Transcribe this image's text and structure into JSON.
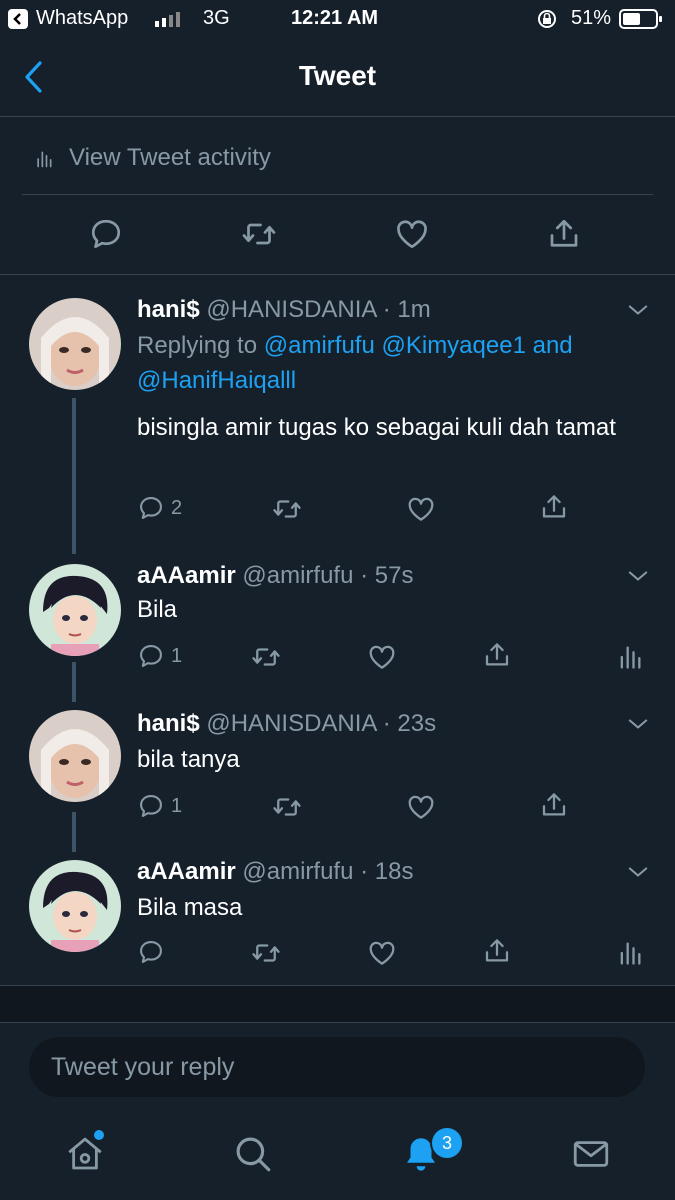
{
  "status_bar": {
    "back_app": "WhatsApp",
    "network": "3G",
    "time": "12:21 AM",
    "battery": "51%"
  },
  "nav": {
    "title": "Tweet"
  },
  "activity": {
    "label": "View Tweet activity"
  },
  "tweets": [
    {
      "name": "hani$",
      "handle": "@HANISDANIA",
      "time": "1m",
      "reply_prefix": "Replying to ",
      "reply_users": [
        "@amirfufu",
        "@Kimyaqee1"
      ],
      "reply_and": " and ",
      "reply_last": "@HanifHaiqalll",
      "text": "bisingla amir tugas ko sebagai kuli dah tamat",
      "replies": "2"
    },
    {
      "name": "aAAamir",
      "handle": "@amirfufu",
      "time": "57s",
      "text": "Bila",
      "replies": "1"
    },
    {
      "name": "hani$",
      "handle": "@HANISDANIA",
      "time": "23s",
      "text": "bila tanya",
      "replies": "1"
    },
    {
      "name": "aAAamir",
      "handle": "@amirfufu",
      "time": "18s",
      "text": "Bila masa",
      "replies": ""
    }
  ],
  "reply_box": {
    "placeholder": "Tweet your reply"
  },
  "tabbar": {
    "notifications_badge": "3"
  },
  "colors": {
    "background": "#15202b",
    "accent": "#1da1f2",
    "muted": "#8899a6",
    "divider": "#38444d"
  },
  "icons": [
    "chevron-left-icon",
    "bar-chart-icon",
    "reply-icon",
    "retweet-icon",
    "like-icon",
    "share-icon",
    "home-icon",
    "search-icon",
    "bell-icon",
    "mail-icon"
  ]
}
